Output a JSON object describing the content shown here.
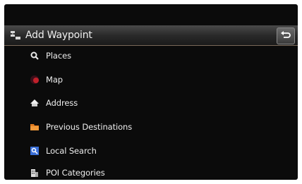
{
  "header": {
    "title": "Add Waypoint"
  },
  "menu": {
    "items": [
      {
        "label": "Places",
        "icon": "magnifier-icon"
      },
      {
        "label": "Map",
        "icon": "map-globe-icon"
      },
      {
        "label": "Address",
        "icon": "house-icon"
      },
      {
        "label": "Previous Destinations",
        "icon": "folder-icon"
      },
      {
        "label": "Local Search",
        "icon": "local-search-icon"
      },
      {
        "label": "POI Categories",
        "icon": "building-icon"
      }
    ]
  },
  "colors": {
    "background": "#0b0b0b",
    "text": "#ededed",
    "header": "#2a2a2a",
    "accent_orange": "#e07a1f",
    "accent_blue": "#3a6fd8",
    "accent_red": "#c0202a"
  }
}
